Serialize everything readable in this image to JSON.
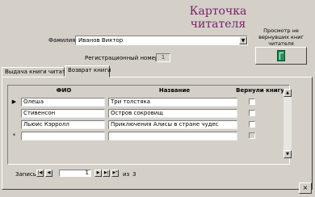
{
  "form": {
    "title": "Карточка читателя",
    "reader_label": "Фамилия",
    "reader_value": "Иванов Виктор",
    "reg_number_label": "Регистрационный номер",
    "reg_number_value": "1",
    "view_caption": "Просмотр не вернувших книг читателя"
  },
  "tabs": [
    {
      "label": "Выдача книги читателю",
      "active": false
    },
    {
      "label": "Возврат книги",
      "active": true
    }
  ],
  "grid": {
    "headers": [
      "ФИО",
      "Название",
      "Вернули книгу"
    ],
    "rows": [
      {
        "marker": "▶",
        "fio": "Олеша",
        "title": "Три толстяка",
        "returned": false
      },
      {
        "marker": "",
        "fio": "Стивенсон",
        "title": "Остров сокровищ",
        "returned": false
      },
      {
        "marker": "",
        "fio": "Льюис Кэрролл",
        "title": "Приключения Алисы в стране чудес",
        "returned": false
      },
      {
        "marker": "*",
        "fio": "",
        "title": "",
        "returned": false
      }
    ]
  },
  "navigator": {
    "label": "Запись:",
    "current": "1",
    "total_prefix": "из",
    "total": "3"
  }
}
